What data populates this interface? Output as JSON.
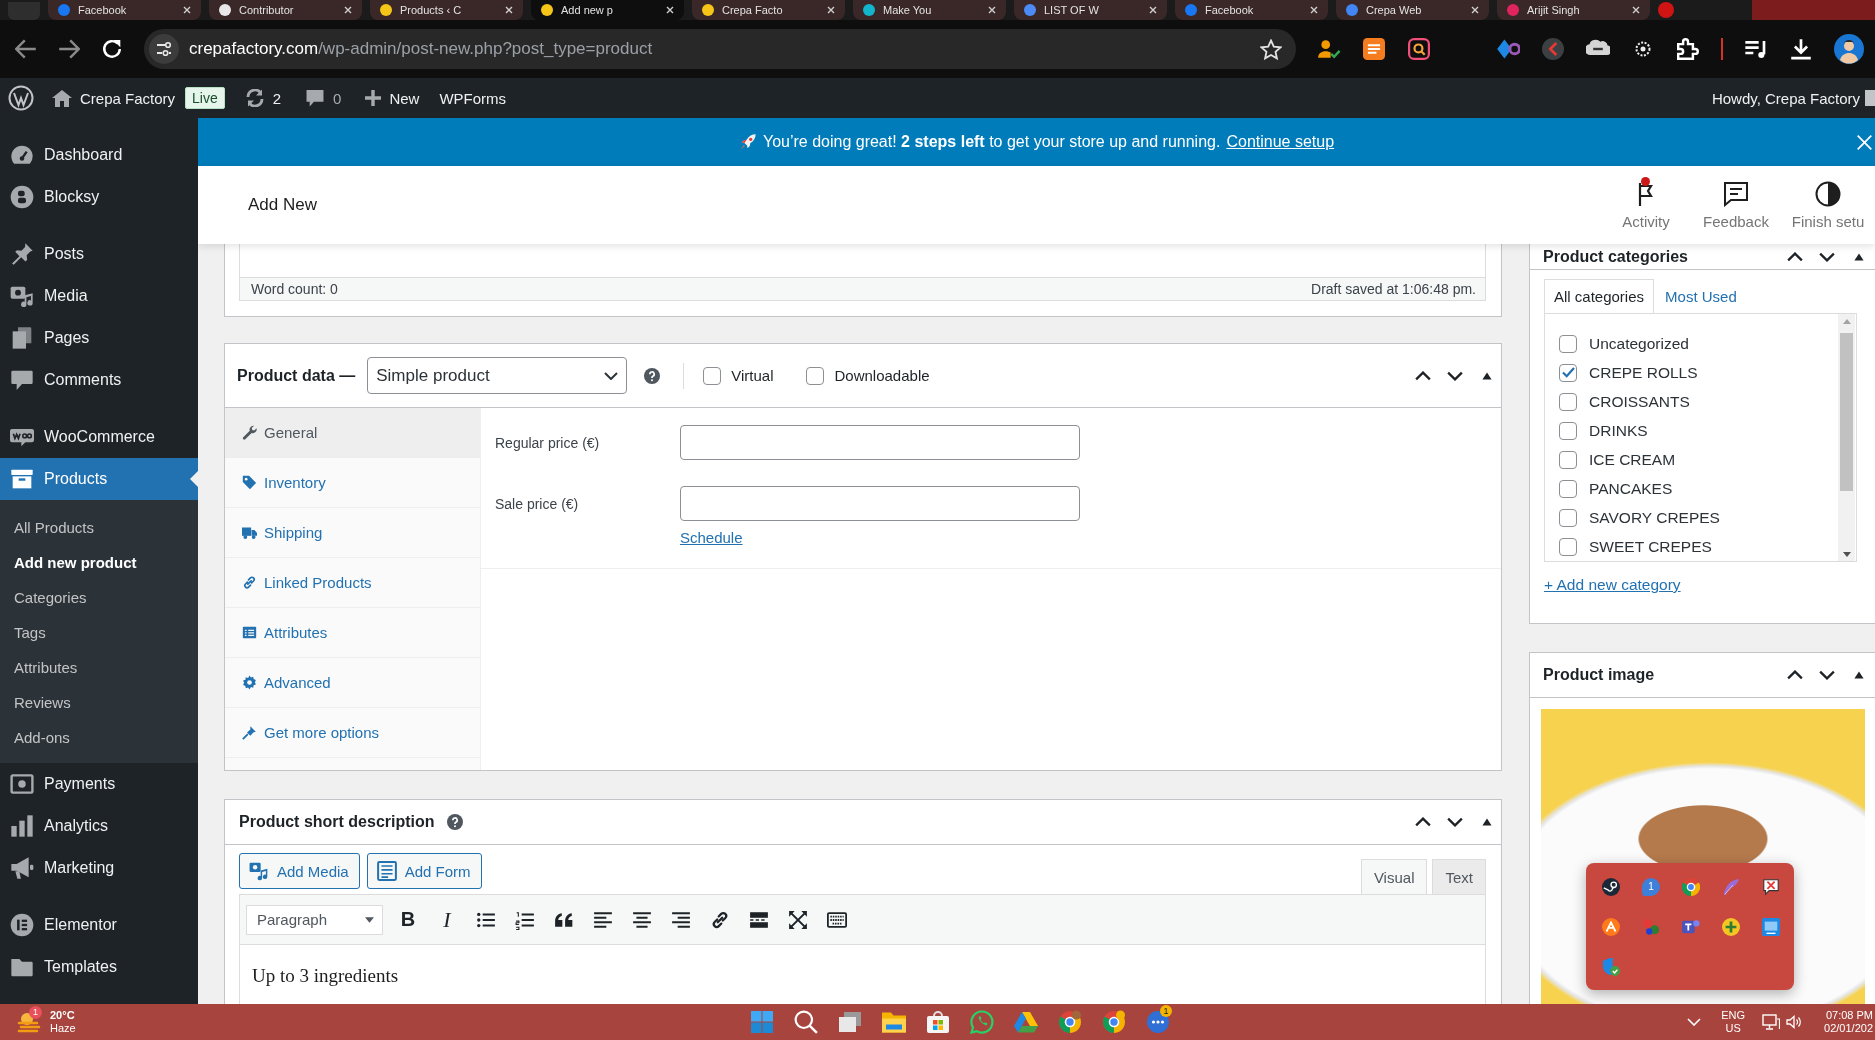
{
  "browser": {
    "tabs": [
      {
        "title": "Facebook",
        "selected": false
      },
      {
        "title": "Contributor",
        "selected": false
      },
      {
        "title": "Products ‹ C",
        "selected": false
      },
      {
        "title": "Add new p",
        "selected": true
      },
      {
        "title": "Crepa Facto",
        "selected": false
      },
      {
        "title": "Make You",
        "selected": false
      },
      {
        "title": "LIST OF W",
        "selected": false
      },
      {
        "title": "Facebook",
        "selected": false
      },
      {
        "title": "Crepa Web",
        "selected": false
      },
      {
        "title": "Arijit Singh",
        "selected": false
      }
    ],
    "address": {
      "domain": "crepafactory.com",
      "path": "/wp-admin/post-new.php?post_type=product"
    }
  },
  "admin_bar": {
    "site_name": "Crepa Factory",
    "badge": "Live",
    "updates": "2",
    "comments": "0",
    "new": "New",
    "forms": "WPForms",
    "greeting": "Howdy, Crepa Factory"
  },
  "sidebar": {
    "groups": [
      {
        "items": [
          {
            "label": "Dashboard",
            "selected": false
          },
          {
            "label": "Blocksy",
            "selected": false
          }
        ]
      },
      {
        "items": [
          {
            "label": "Posts",
            "selected": false
          },
          {
            "label": "Media",
            "selected": false
          },
          {
            "label": "Pages",
            "selected": false
          },
          {
            "label": "Comments",
            "selected": false
          }
        ]
      },
      {
        "items": [
          {
            "label": "WooCommerce",
            "selected": false
          },
          {
            "label": "Products",
            "selected": true,
            "children": [
              {
                "label": "All Products",
                "selected": false
              },
              {
                "label": "Add new product",
                "selected": true
              },
              {
                "label": "Categories",
                "selected": false
              },
              {
                "label": "Tags",
                "selected": false
              },
              {
                "label": "Attributes",
                "selected": false
              },
              {
                "label": "Reviews",
                "selected": false
              },
              {
                "label": "Add-ons",
                "selected": false
              }
            ]
          },
          {
            "label": "Payments",
            "selected": false
          },
          {
            "label": "Analytics",
            "selected": false
          },
          {
            "label": "Marketing",
            "selected": false
          }
        ]
      },
      {
        "items": [
          {
            "label": "Elementor",
            "selected": false
          },
          {
            "label": "Templates",
            "selected": false
          }
        ]
      }
    ]
  },
  "banner": {
    "message": "You’re doing great! **2 steps left** to get your store up and running.",
    "link": "Continue setup"
  },
  "header": {
    "title": "Add New",
    "actions": [
      {
        "label": "Activity",
        "alert": true
      },
      {
        "label": "Feedback",
        "alert": false
      },
      {
        "label": "Finish setu",
        "alert": false
      }
    ]
  },
  "editor": {
    "word_count": "Word count: 0",
    "draft_status": "Draft saved at 1:06:48 pm."
  },
  "product_data": {
    "title": "Product data —",
    "type_select": "Simple product",
    "options": [
      {
        "label": "Virtual",
        "checked": false
      },
      {
        "label": "Downloadable",
        "checked": false
      }
    ],
    "tabs": [
      {
        "label": "General",
        "selected": true
      },
      {
        "label": "Inventory",
        "selected": false
      },
      {
        "label": "Shipping",
        "selected": false
      },
      {
        "label": "Linked Products",
        "selected": false
      },
      {
        "label": "Attributes",
        "selected": false
      },
      {
        "label": "Advanced",
        "selected": false
      },
      {
        "label": "Get more options",
        "selected": false
      }
    ],
    "fields": [
      {
        "label": "Regular price (€)"
      },
      {
        "label": "Sale price (€)"
      }
    ],
    "schedule_link": "Schedule"
  },
  "short_description": {
    "title": "Product short description",
    "buttons": [
      "Add Media",
      "Add Form"
    ],
    "editor_tabs": [
      {
        "label": "Visual",
        "selected": true
      },
      {
        "label": "Text",
        "selected": false
      }
    ],
    "format": "Paragraph",
    "text_buttons": [
      "B",
      "I"
    ],
    "content": "Up to 3 ingredients"
  },
  "categories": {
    "title": "Product categories",
    "tabs": [
      {
        "label": "All categories",
        "selected": true
      },
      {
        "label": "Most Used",
        "selected": false
      }
    ],
    "items": [
      {
        "label": "Uncategorized",
        "checked": false
      },
      {
        "label": "CREPE ROLLS",
        "checked": true
      },
      {
        "label": "CROISSANTS",
        "checked": false
      },
      {
        "label": "DRINKS",
        "checked": false
      },
      {
        "label": "ICE CREAM",
        "checked": false
      },
      {
        "label": "PANCAKES",
        "checked": false
      },
      {
        "label": "SAVORY CREPES",
        "checked": false
      },
      {
        "label": "SWEET CREPES",
        "checked": false
      }
    ],
    "add_link": "+ Add new category"
  },
  "product_image": {
    "title": "Product image"
  },
  "tray_overflow": {
    "badge": "1"
  },
  "taskbar": {
    "weather_badge": "1",
    "temperature": "20°C",
    "condition": "Haze",
    "app_badge": "1",
    "language": "ENG",
    "region": "US",
    "time": "07:08 PM",
    "date": "02/01/202"
  }
}
